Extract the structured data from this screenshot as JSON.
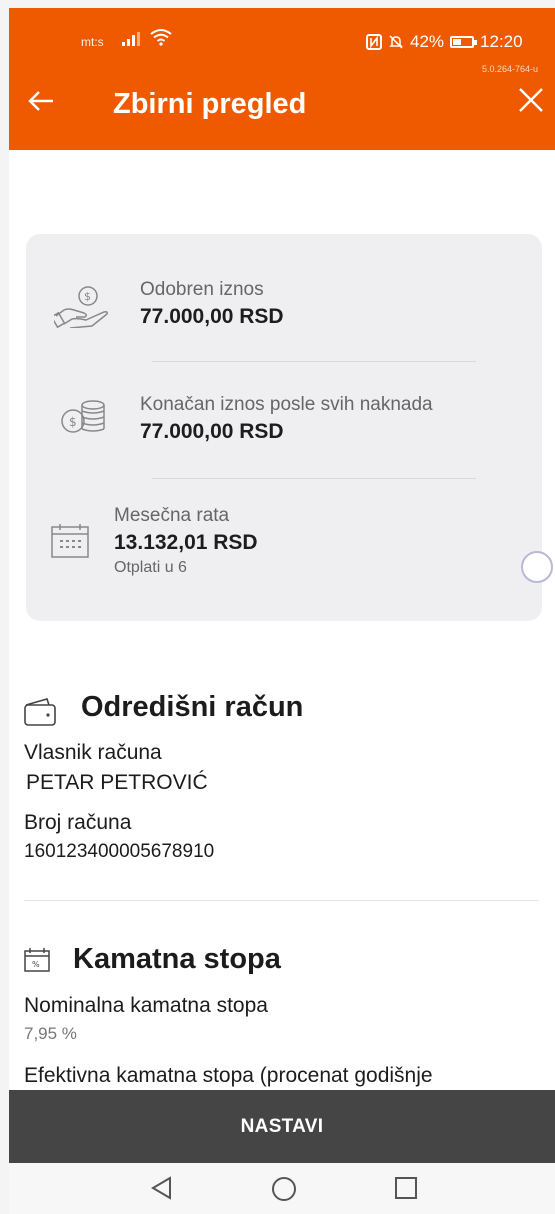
{
  "status_bar": {
    "carrier": "mt:s",
    "battery_text": "42%",
    "battery_level": 0.42,
    "time": "12:20",
    "version": "5.0.264-764-u"
  },
  "header": {
    "title": "Zbirni pregled",
    "back_icon": "back-arrow-icon",
    "close_icon": "close-icon"
  },
  "summary": {
    "approved": {
      "label": "Odobren iznos",
      "value": "77.000,00 RSD"
    },
    "final": {
      "label": "Konačan iznos posle svih naknada",
      "value": "77.000,00 RSD"
    },
    "monthly": {
      "label": "Mesečna rata",
      "value": "13.132,01 RSD",
      "sub": "Otplati u 6"
    }
  },
  "destination": {
    "title": "Odredišni račun",
    "owner_label": "Vlasnik računa",
    "owner_value": "PETAR PETROVIĆ",
    "number_label": "Broj računa",
    "number_value": "160123400005678910"
  },
  "interest": {
    "title": "Kamatna stopa",
    "nominal_label": "Nominalna kamatna stopa",
    "nominal_value": "7,95 %",
    "effective_label": "Efektivna kamatna stopa (procenat godišnje"
  },
  "actions": {
    "continue_label": "NASTAVI"
  },
  "colors": {
    "brand": "#ef5a00",
    "button": "#454545",
    "card": "#efeff1"
  }
}
